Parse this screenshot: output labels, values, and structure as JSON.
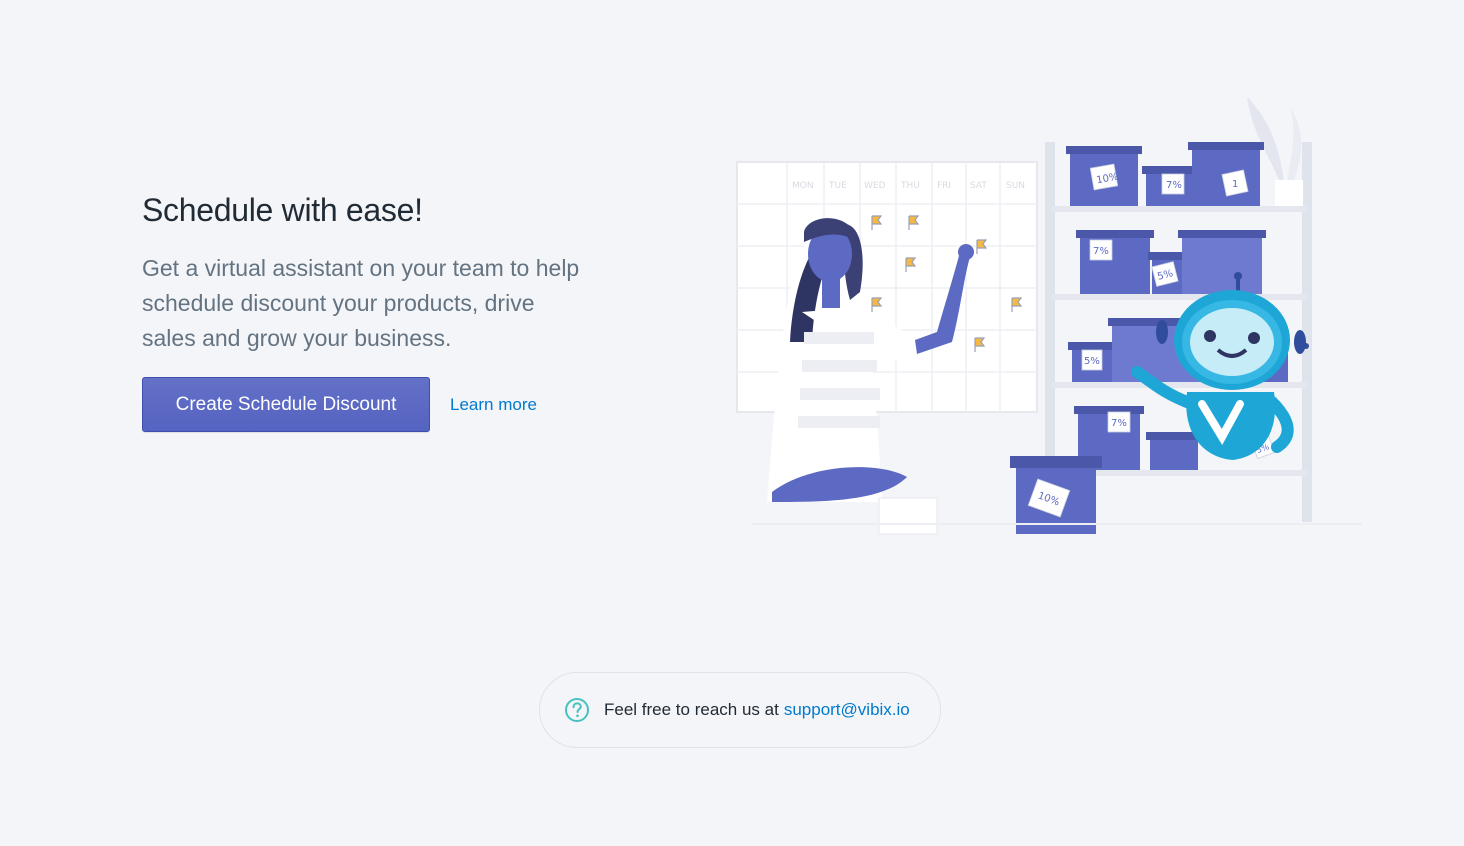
{
  "hero": {
    "title": "Schedule with ease!",
    "description": "Get a virtual assistant on your team to help schedule discount your products, drive sales and grow your business.",
    "primary_button": "Create Schedule Discount",
    "secondary_link": "Learn more"
  },
  "illustration": {
    "calendar_days": [
      "MON",
      "TUE",
      "WED",
      "THU",
      "FRI",
      "SAT",
      "SUN"
    ],
    "box_labels": [
      "10%",
      "7%",
      "1",
      "7%",
      "5%",
      "5%",
      "7%",
      "10%",
      "5%"
    ]
  },
  "footer": {
    "text": "Feel free to reach us at",
    "email": "support@vibix.io",
    "icon": "question-circle-icon"
  },
  "colors": {
    "primary": "#5c6ac4",
    "link": "#007ace",
    "accent_teal": "#47c1bf",
    "box_purple": "#5c6ac4"
  }
}
